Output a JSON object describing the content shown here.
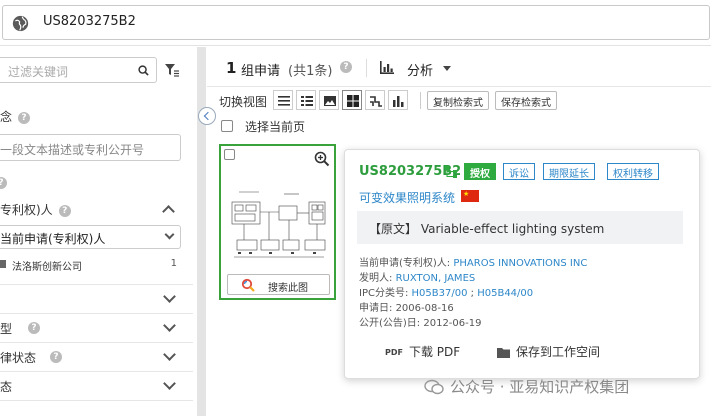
{
  "search": {
    "query": "US8203275B2"
  },
  "sidebar": {
    "filter_placeholder": "过滤关键词",
    "section1_label": "念",
    "section1_placeholder": "一段文本描述或专利公开号",
    "assignee_section_label": "专利权)人",
    "assignee_select_value": "当前申请(专利权)人",
    "assignee_item": {
      "name": "法洛斯创新公司",
      "count": "1"
    },
    "rows": [
      "",
      "型",
      "律状态",
      "态"
    ]
  },
  "results": {
    "group_count": "1",
    "group_label": "组申请",
    "count_sub": "(共1条)",
    "analysis_label": "分析",
    "view_label": "切换视图",
    "copy_query_button": "复制检索式",
    "save_query_button": "保存检索式",
    "select_page_label": "选择当前页",
    "find_by_image_button": "搜索此图"
  },
  "popover": {
    "patent_number": "US8203275B2",
    "badges": [
      "授权",
      "诉讼",
      "期限延长",
      "权利转移"
    ],
    "title_cn": "可变效果照明系统",
    "orig_prefix": "【原文】",
    "orig_title": "Variable-effect lighting system",
    "assignee_label": "当前申请(专利权)人:",
    "assignee_value": "PHAROS INNOVATIONS INC",
    "inventor_label": "发明人:",
    "inventor_value": "RUXTON, JAMES",
    "ipc_label": "IPC分类号:",
    "ipc_value1": "H05B37/00",
    "ipc_sep": " ;",
    "ipc_value2": "H05B44/00",
    "filing_label": "申请日:",
    "filing_value": "2006-08-16",
    "pub_label": "公开(公告)日:",
    "pub_value": "2012-06-19",
    "pdf_icon_text": "PDF",
    "download_label": "下载 PDF",
    "save_workspace_label": "保存到工作空间"
  },
  "watermark": {
    "text": "公众号 · 亚易知识产权集团"
  },
  "colors": {
    "accent_blue": "#2e87c9",
    "grant_green": "#2eaa3f",
    "selection_green": "#3aa23a"
  }
}
